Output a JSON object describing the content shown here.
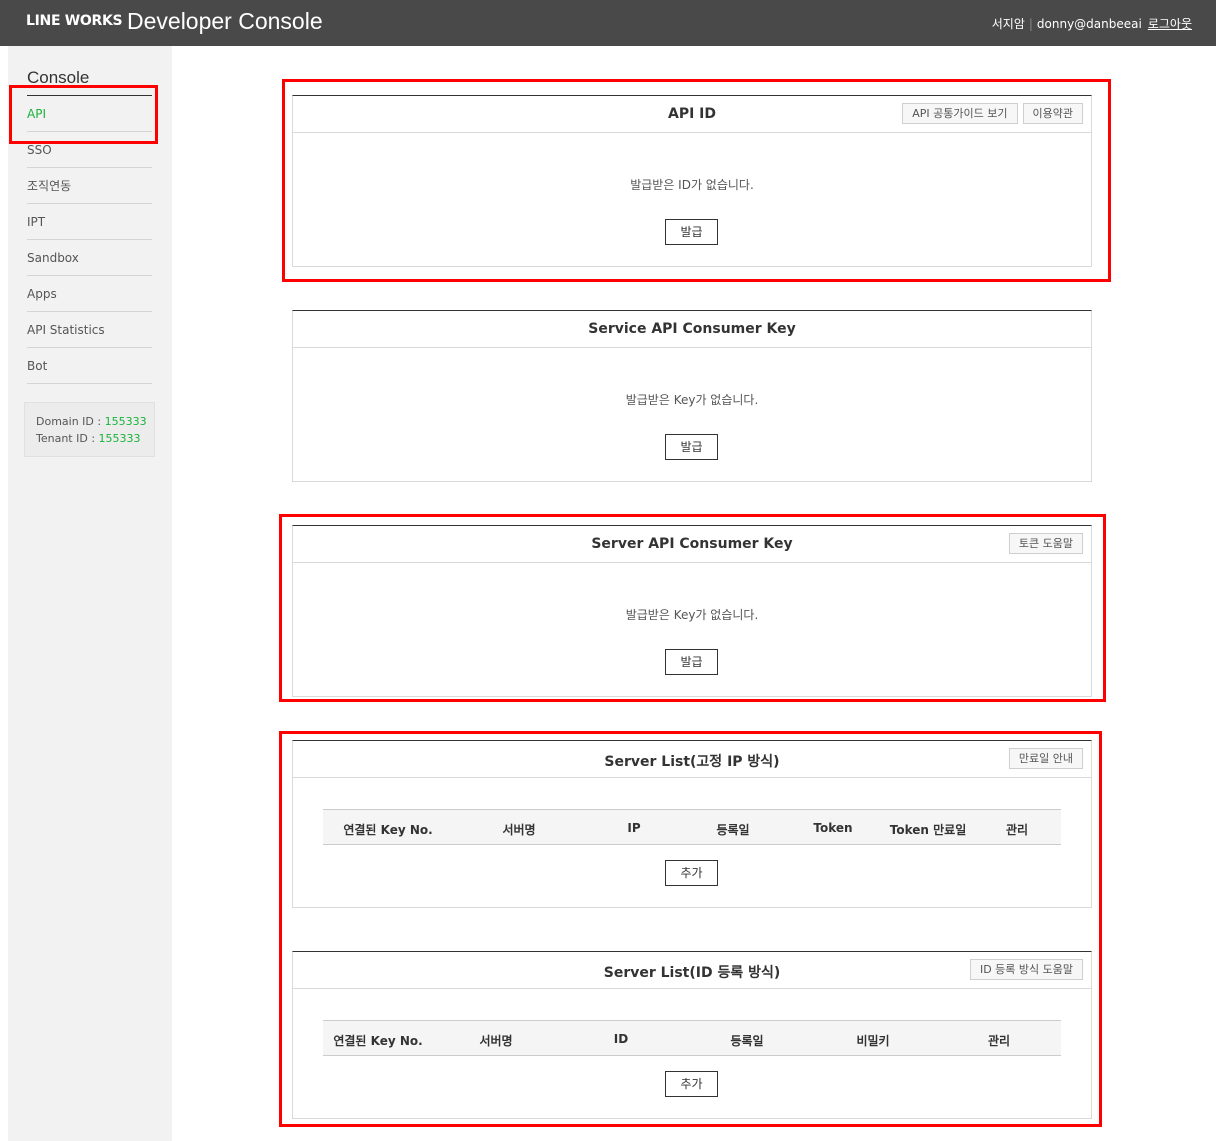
{
  "header": {
    "brand": "LINE WORKS",
    "title": "Developer Console",
    "user_name": "서지암",
    "user_email": "donny@danbeeai",
    "logout": "로그아웃"
  },
  "sidebar": {
    "title": "Console",
    "items": [
      {
        "label": "API"
      },
      {
        "label": "SSO"
      },
      {
        "label": "조직연동"
      },
      {
        "label": "IPT"
      },
      {
        "label": "Sandbox"
      },
      {
        "label": "Apps"
      },
      {
        "label": "API Statistics"
      },
      {
        "label": "Bot"
      }
    ],
    "domain_id_label": "Domain ID : ",
    "domain_id": "155333",
    "tenant_id_label": "Tenant ID : ",
    "tenant_id": "155333"
  },
  "api_id": {
    "title": "API ID",
    "guide_button": "API 공통가이드 보기",
    "terms_button": "이용약관",
    "empty": "발급받은 ID가 없습니다.",
    "issue": "발급"
  },
  "service_key": {
    "title": "Service API Consumer Key",
    "empty": "발급받은 Key가 없습니다.",
    "issue": "발급"
  },
  "server_key": {
    "title": "Server API Consumer Key",
    "help_button": "토큰 도움말",
    "empty": "발급받은 Key가 없습니다.",
    "issue": "발급"
  },
  "server_list_ip": {
    "title": "Server List(고정 IP 방식)",
    "help_button": "만료일 안내",
    "columns": [
      "연결된 Key No.",
      "서버명",
      "IP",
      "등록일",
      "Token",
      "Token 만료일",
      "관리"
    ],
    "add": "추가"
  },
  "server_list_id": {
    "title": "Server List(ID 등록 방식)",
    "help_button": "ID 등록 방식 도움말",
    "columns": [
      "연결된 Key No.",
      "서버명",
      "ID",
      "등록일",
      "비밀키",
      "관리"
    ],
    "add": "추가"
  },
  "colors": {
    "topbar": "#494949",
    "accent_green": "#19b33a",
    "highlight_red": "#ff0000"
  }
}
